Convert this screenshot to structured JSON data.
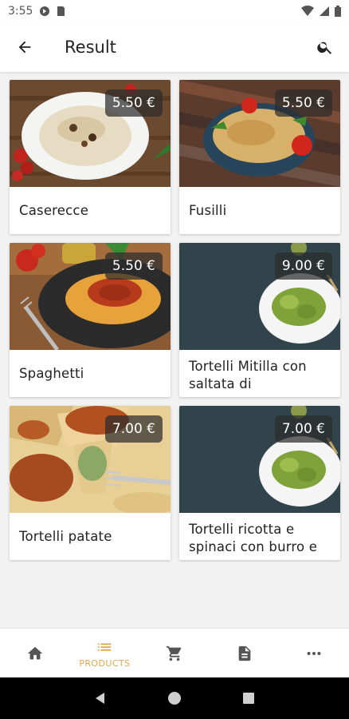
{
  "status_bar": {
    "time": "3:55"
  },
  "app_bar": {
    "title": "Result"
  },
  "products": [
    {
      "name": "Caserecce",
      "price": "5.50 €",
      "image": "caserecce-photo"
    },
    {
      "name": "Fusilli",
      "price": "5.50 €",
      "image": "fusilli-photo"
    },
    {
      "name": "Spaghetti",
      "price": "5.50 €",
      "image": "spaghetti-photo"
    },
    {
      "name": "Tortelli Mitilla con saltata di",
      "price": "9.00 €",
      "image": "tortelli-mitilla-photo"
    },
    {
      "name": "Tortelli patate",
      "price": "7.00 €",
      "image": "tortelli-patate-photo"
    },
    {
      "name": "Tortelli ricotta e spinaci con burro e",
      "price": "7.00 €",
      "image": "tortelli-ricotta-photo"
    }
  ],
  "bottom_nav": {
    "items": [
      {
        "icon": "home-icon",
        "label": ""
      },
      {
        "icon": "list-icon",
        "label": "PRODUCTS"
      },
      {
        "icon": "cart-icon",
        "label": ""
      },
      {
        "icon": "document-icon",
        "label": ""
      },
      {
        "icon": "more-icon",
        "label": ""
      }
    ]
  },
  "colors": {
    "accent": "#e0a64a",
    "background": "#f2f2f2",
    "card": "#ffffff",
    "price_bg": "#2d2d2d"
  }
}
